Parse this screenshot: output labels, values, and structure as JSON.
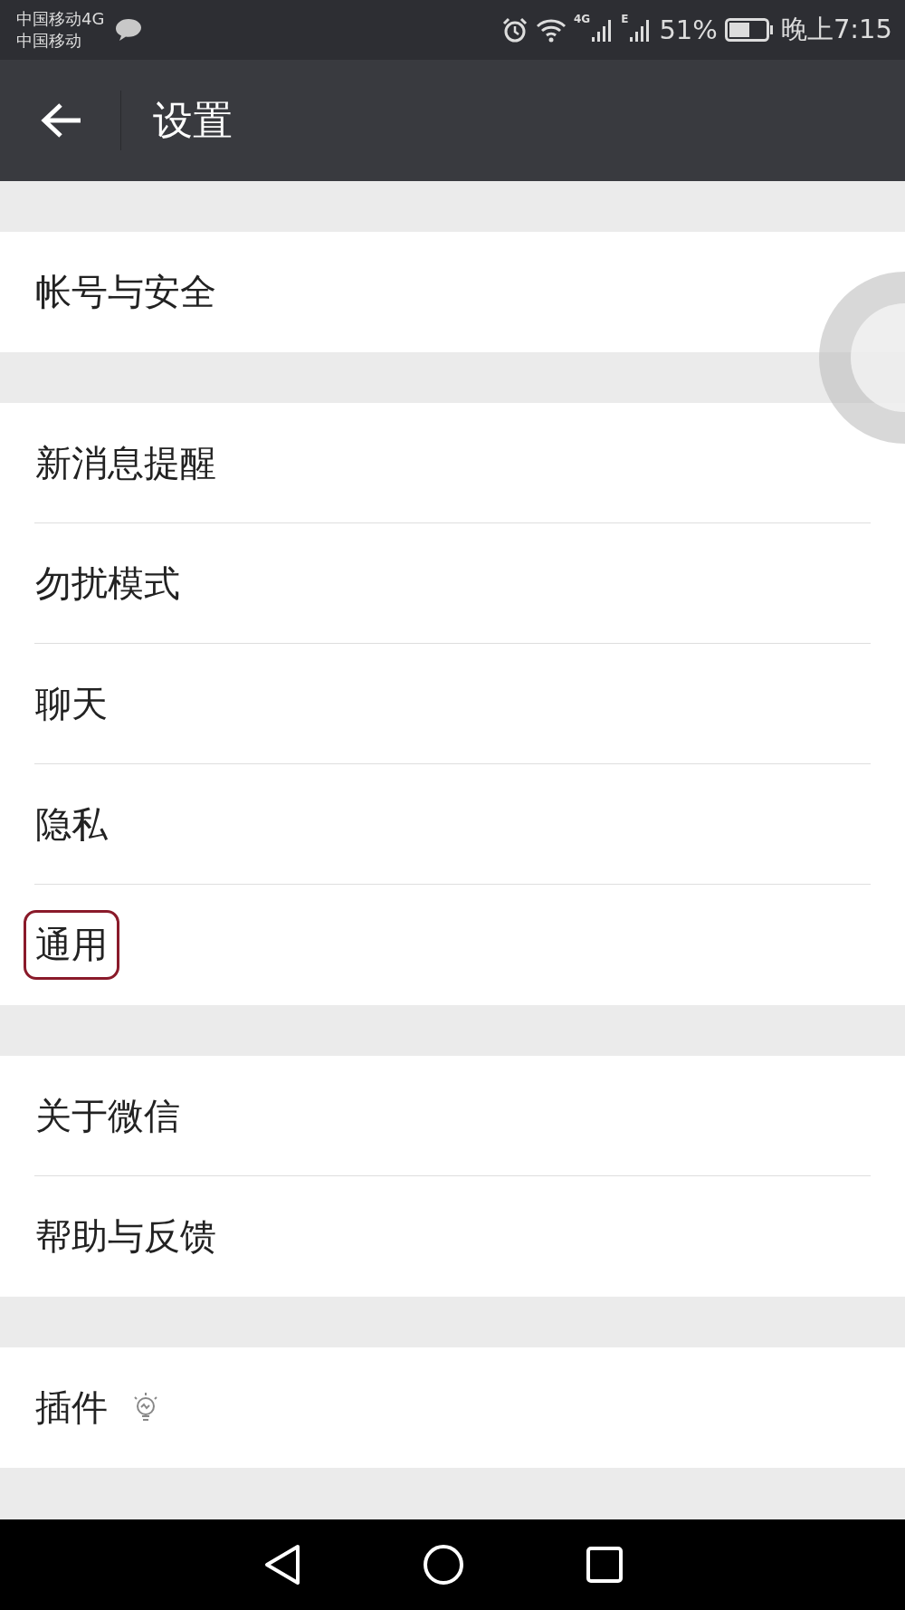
{
  "status_bar": {
    "carriers": [
      "中国移动4G",
      "中国移动"
    ],
    "network_4g": "4G",
    "network_e": "E",
    "battery": "51%",
    "time": "晚上7:15"
  },
  "header": {
    "title": "设置"
  },
  "groups": [
    {
      "items": [
        {
          "label": "帐号与安全",
          "highlighted": false
        }
      ]
    },
    {
      "items": [
        {
          "label": "新消息提醒",
          "highlighted": false
        },
        {
          "label": "勿扰模式",
          "highlighted": false
        },
        {
          "label": "聊天",
          "highlighted": false
        },
        {
          "label": "隐私",
          "highlighted": false
        },
        {
          "label": "通用",
          "highlighted": true
        }
      ]
    },
    {
      "items": [
        {
          "label": "关于微信",
          "highlighted": false
        },
        {
          "label": "帮助与反馈",
          "highlighted": false
        }
      ]
    },
    {
      "items": [
        {
          "label": "插件",
          "highlighted": false,
          "kind": "with-bulb"
        }
      ]
    }
  ]
}
